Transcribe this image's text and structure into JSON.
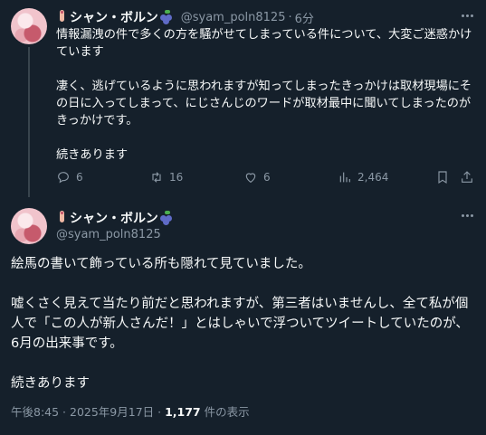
{
  "tweet1": {
    "display_name": "シャン・ボルン",
    "handle": "@syam_poln8125",
    "separator": "·",
    "time_ago": "6分",
    "text": "情報漏洩の件で多くの方を騒がせてしまっている件について、大変ご迷惑かけています\n\n凄く、逃げているように思われますが知ってしまったきっかけは取材現場にその日に入ってしまって、にじさんじのワードが取材最中に聞いてしまったのがきっかけです。\n\n続きあります",
    "reply_count": "6",
    "retweet_count": "16",
    "like_count": "6",
    "view_count": "2,464"
  },
  "tweet2": {
    "display_name": "シャン・ボルン",
    "handle": "@syam_poln8125",
    "text": "絵馬の書いて飾っている所も隠れて見ていました。\n\n嘘くさく見えて当たり前だと思われますが、第三者はいませんし、全て私が個人で「この人が新人さんだ！」とはしゃいで浮ついてツイートしていたのが、6月の出来事です。\n\n続きあります",
    "timestamp": "午後8:45 · 2025年9月17日 · ",
    "views_count": "1,177",
    "views_label": " 件の表示"
  },
  "icons": {
    "hand": "pointing-finger-emoji",
    "berry": "blueberries-emoji",
    "more": "more-horizontal-icon",
    "reply": "reply-icon",
    "retweet": "retweet-icon",
    "like": "heart-icon",
    "views": "views-chart-icon",
    "bookmark": "bookmark-icon",
    "share": "share-icon"
  },
  "colors": {
    "background": "#15202b",
    "text": "#f7f9f9",
    "secondary": "#8b98a5",
    "thread_line": "#38444d"
  }
}
